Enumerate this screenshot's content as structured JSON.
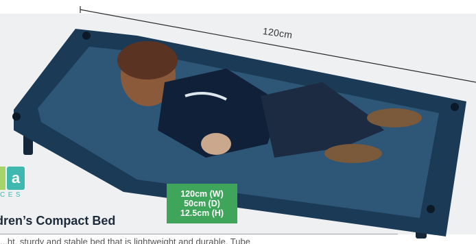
{
  "dimension_label": "120cm",
  "brand": {
    "logo_glyph": "a",
    "tagline": "CES",
    "accent_color": "#3fb8b0"
  },
  "product": {
    "title": "dren’s Compact Bed",
    "description": "...ht, sturdy and stable bed that is lightweight and durable. Tube"
  },
  "dimensions_badge": {
    "width": "120cm (W)",
    "depth": "50cm (D)",
    "height": "12.5cm (H)",
    "color": "#3ea55a"
  }
}
